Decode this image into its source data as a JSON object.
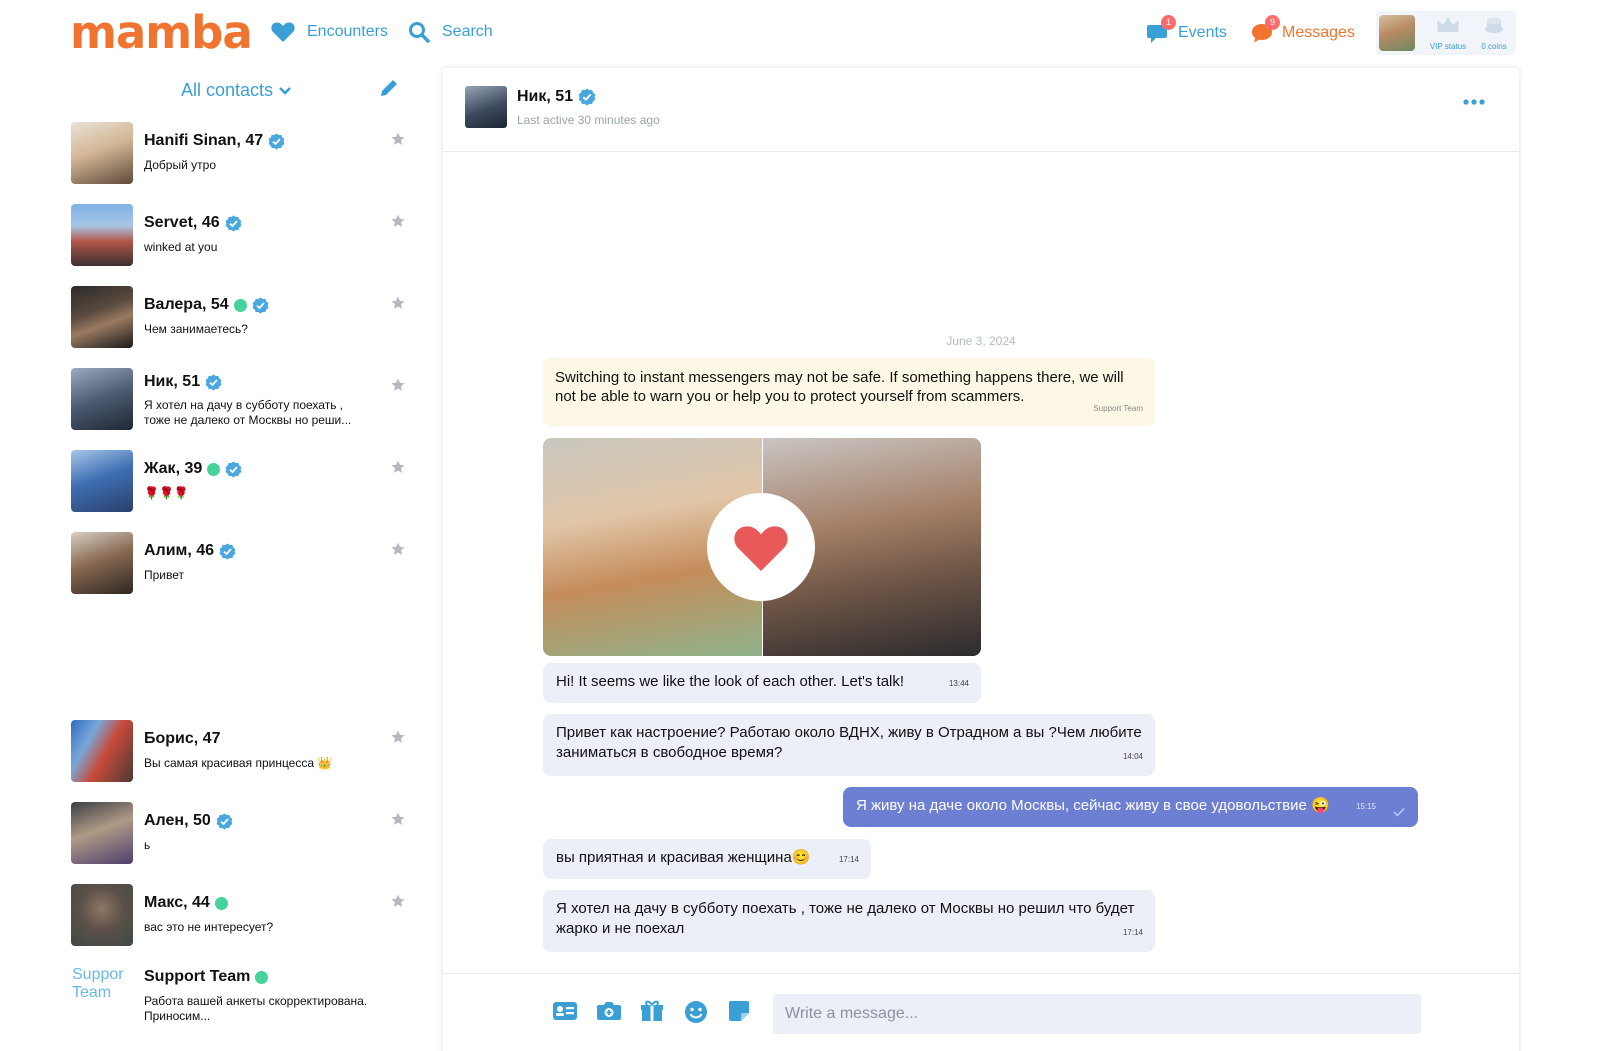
{
  "header": {
    "logo": "mamba",
    "nav": {
      "encounters": "Encounters",
      "search": "Search",
      "events": "Events",
      "messages": "Messages"
    },
    "badges": {
      "events": "1",
      "messages": "9"
    },
    "vip_status": "VIP status",
    "coins": "0 coins"
  },
  "sidebar": {
    "filter_label": "All contacts",
    "contacts": [
      {
        "name": "Hanifi Sinan, 47",
        "preview": "Добрый утро"
      },
      {
        "name": "Servet, 46",
        "preview": "winked at you"
      },
      {
        "name": "Валера, 54",
        "preview": "Чем занимаетесь?"
      },
      {
        "name": "Ник, 51",
        "preview": "Я хотел на дачу в субботу поехать , тоже не далеко от Москвы но реши..."
      },
      {
        "name": "Жак, 39",
        "preview": "🌹🌹🌹"
      },
      {
        "name": "Алим, 46",
        "preview": "Привет"
      },
      {
        "name": "Борис, 47",
        "preview": "Вы самая красивая принцесса 👑"
      },
      {
        "name": "Ален, 50",
        "preview": "ь"
      },
      {
        "name": "Макс, 44",
        "preview": "вас это не интересует?"
      },
      {
        "name": "Support Team",
        "preview": "Работа вашей анкеты скорректирована. Приносим...",
        "logo_text": "Suppor Team"
      }
    ]
  },
  "chat": {
    "contact_name": "Ник, 51",
    "status": "Last active 30 minutes ago",
    "date": "June 3, 2024",
    "warning": {
      "text": "Switching to instant messengers may not be safe. If something happens there, we will not be able to warn you or help you to protect yourself from scammers.",
      "from": "Support Team"
    },
    "messages": [
      {
        "text": "Hi! It seems we like the look of each other. Let's talk!",
        "time": "13:44"
      },
      {
        "text": "Привет как настроение? Работаю около ВДНХ, живу в Отрадном а вы ?Чем любите заниматься в свободное время?",
        "time": "14:04"
      },
      {
        "text": "Я живу на даче около Москвы, сейчас живу в свое удовольствие 😜",
        "time": "15:15"
      },
      {
        "text": "вы приятная и красивая женщина😊",
        "time": "17:14"
      },
      {
        "text": "Я хотел на дачу в субботу поехать , тоже не далеко от Москвы но решил что будет жарко и не поехал",
        "time": "17:14"
      }
    ],
    "input_placeholder": "Write a message..."
  },
  "colors": {
    "brand": "#f0742f",
    "accent": "#3a9fd5",
    "outgoing": "#6d7fd2",
    "incoming": "#eceff7",
    "online": "#45d39b"
  },
  "icons": [
    "heart-icon",
    "search-icon",
    "events-icon",
    "messages-icon",
    "crown-icon",
    "coins-icon",
    "chevron-down-icon",
    "pencil-icon",
    "verified-icon",
    "star-icon",
    "more-icon",
    "contact-card-icon",
    "camera-icon",
    "gift-icon",
    "smile-icon",
    "sticker-icon",
    "check-icon"
  ]
}
